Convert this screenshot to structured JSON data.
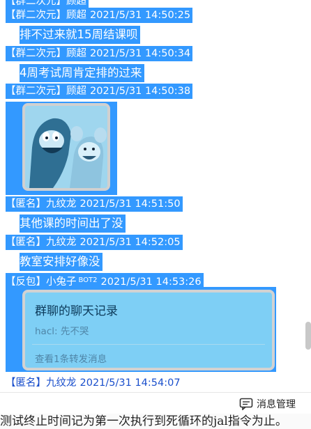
{
  "messages": [
    {
      "sender": "【群二次元】顾超",
      "time": "",
      "text": ""
    },
    {
      "sender": "【群二次元】顾超",
      "time": "2021/5/31 14:50:25",
      "text": "排不过来就15周结课呗"
    },
    {
      "sender": "【群二次元】顾超",
      "time": "2021/5/31 14:50:34",
      "text": "4周考试周肯定排的过来"
    },
    {
      "sender": "【群二次元】顾超",
      "time": "2021/5/31 14:50:38",
      "text": ""
    },
    {
      "sender": "【匿名】九纹龙",
      "time": "2021/5/31 14:51:50",
      "text": "其他课的时间出了没"
    },
    {
      "sender": "【匿名】九纹龙",
      "time": "2021/5/31 14:52:05",
      "text": "教室安排好像没"
    },
    {
      "sender": "【反包】小兔子",
      "bot_badge": "BOT2",
      "time": "2021/5/31 14:53:26",
      "text": ""
    },
    {
      "sender": "【匿名】九纹龙",
      "time": "2021/5/31 14:54:07",
      "text": ""
    }
  ],
  "forward_card": {
    "title": "群聊的聊天记录",
    "preview": "hacl:  先不哭",
    "footer": "查看1条转发消息"
  },
  "toolbar": {
    "manager_label": "消息管理",
    "manager_icon": "chat-bubble-icon"
  },
  "bottom_text": "测试终止时间记为第一次执行到死循环的jal指令为止。",
  "colors": {
    "selection": "#3399ff",
    "card_bg": "#7ecff5",
    "sender_blue": "#1a4fcc"
  }
}
